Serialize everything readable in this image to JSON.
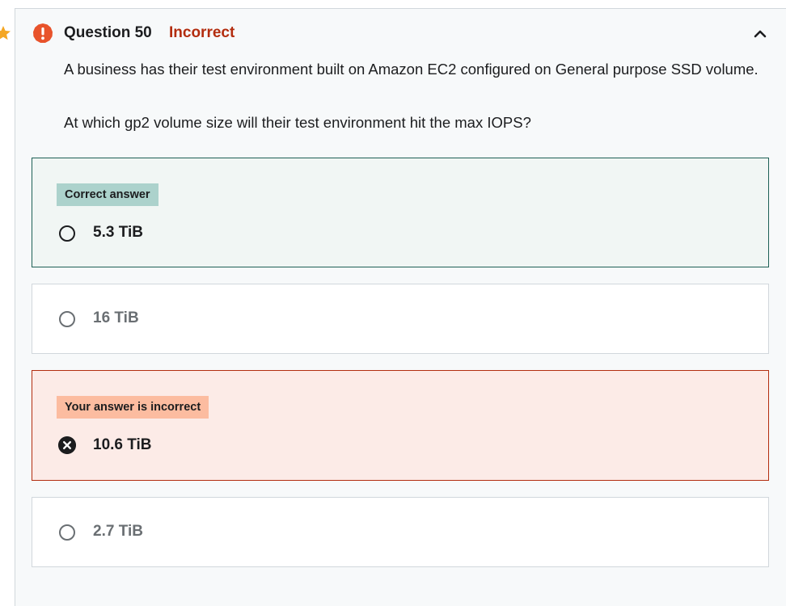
{
  "question": {
    "title": "Question 50",
    "status": "Incorrect",
    "status_color": "#b32d0f",
    "text_line1": "A business has their test environment built on Amazon EC2 configured on General purpose SSD volume.",
    "text_line2": "At which gp2 volume size will their test environment hit the max IOPS?"
  },
  "options": [
    {
      "label": "5.3 TiB",
      "badge": "Correct answer",
      "state": "correct"
    },
    {
      "label": "16 TiB",
      "state": "neutral"
    },
    {
      "label": "10.6 TiB",
      "badge": "Your answer is incorrect",
      "state": "selected-incorrect"
    },
    {
      "label": "2.7 TiB",
      "state": "neutral"
    }
  ],
  "icons": {
    "star": "star-icon",
    "alert": "alert-icon",
    "collapse": "chevron-up-icon",
    "radio": "radio-icon",
    "incorrect": "x-circle-icon"
  },
  "colors": {
    "correct_border": "#1e6055",
    "correct_badge": "#acd2cc",
    "incorrect_border": "#b32d0f",
    "incorrect_badge": "#fcbca0",
    "star": "#f4a623",
    "alert": "#e8532b"
  }
}
